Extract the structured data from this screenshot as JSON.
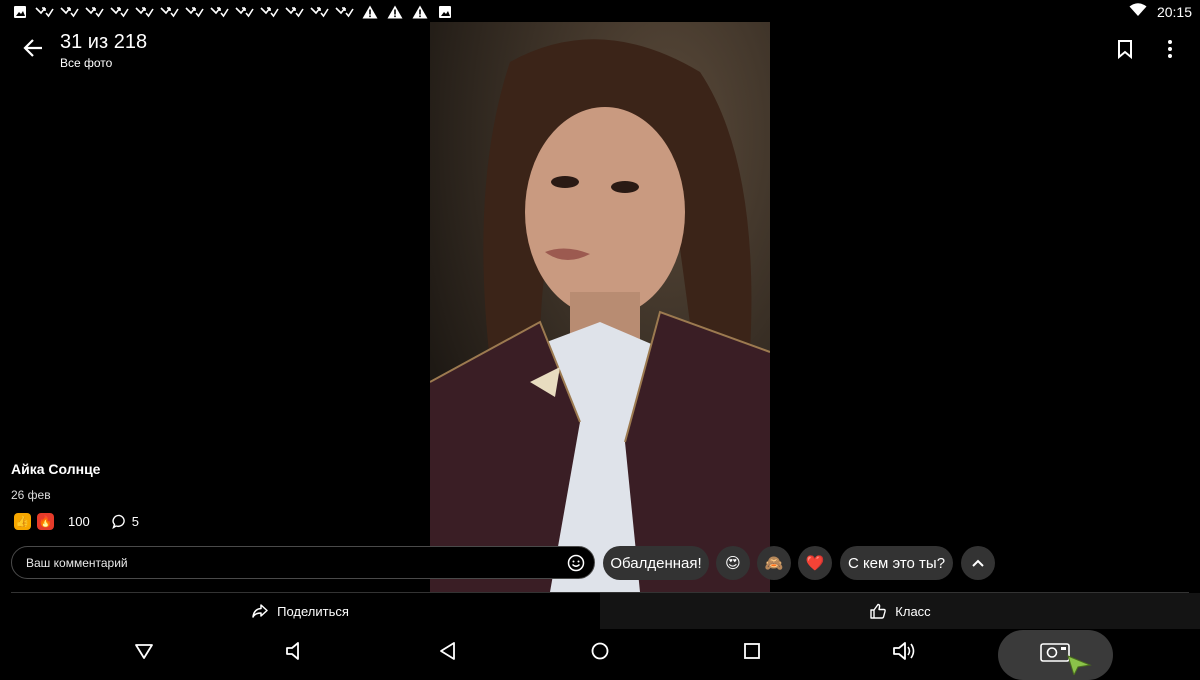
{
  "status_bar": {
    "time": "20:15",
    "notification_icons": [
      "image-icon",
      "missed-call-icon",
      "missed-call-icon",
      "missed-call-icon",
      "missed-call-icon",
      "missed-call-icon",
      "missed-call-icon",
      "missed-call-icon",
      "missed-call-icon",
      "missed-call-icon",
      "missed-call-icon",
      "missed-call-icon",
      "missed-call-icon",
      "missed-call-icon",
      "warning-icon",
      "warning-icon",
      "warning-icon",
      "image-icon"
    ]
  },
  "header": {
    "title": "31 из 218",
    "subtitle": "Все фото"
  },
  "post": {
    "author": "Айка Солнце",
    "date": "26 фев",
    "reactions_count": "100",
    "comments_count": "5"
  },
  "comment": {
    "placeholder": "Ваш комментарий"
  },
  "quick_replies": {
    "text1": "Обалденная!",
    "emoji1": "😍",
    "emoji2": "🙈",
    "emoji3": "❤️",
    "text2": "С кем это ты?"
  },
  "actions": {
    "share_label": "Поделиться",
    "like_label": "Класс"
  },
  "colors": {
    "background": "#000000",
    "chip_background": "#333333",
    "accent_orange": "#f7a700",
    "accent_red": "#e53b2a"
  }
}
